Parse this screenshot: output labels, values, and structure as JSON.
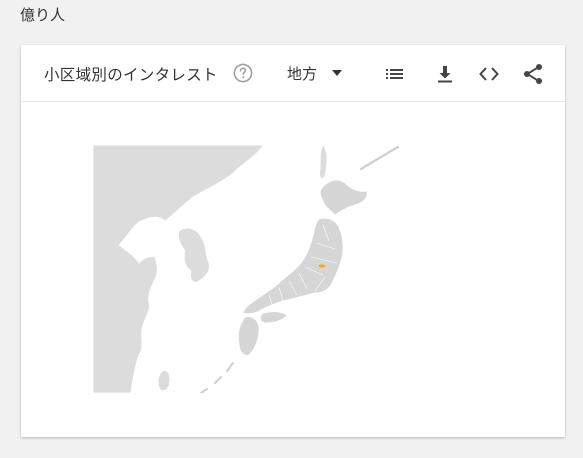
{
  "page": {
    "title": "億り人"
  },
  "widget": {
    "title": "小区域別のインタレスト",
    "resolution_label": "地方",
    "icons": {
      "help": "help-circle-icon",
      "dropdown": "caret-down-icon",
      "list": "list-icon",
      "download": "download-icon",
      "embed": "code-icon",
      "share": "share-icon"
    },
    "map": {
      "region": "Japan",
      "land_color": "#dcdcdc",
      "data_color": "#cfcfcf",
      "border_color": "#ffffff",
      "highlight_color": "#f2b400"
    }
  }
}
